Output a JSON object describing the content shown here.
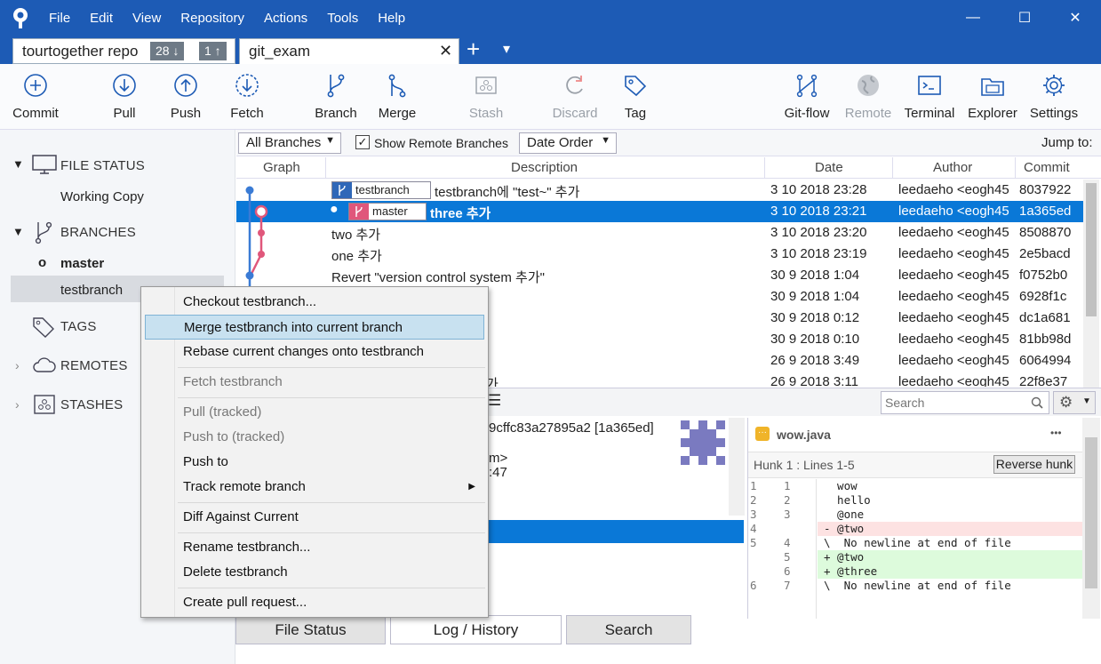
{
  "titlebar": {
    "menu": [
      "File",
      "Edit",
      "View",
      "Repository",
      "Actions",
      "Tools",
      "Help"
    ],
    "minimize_glyph": "—",
    "maximize_glyph": "☐",
    "close_glyph": "✕"
  },
  "tabs": {
    "tab1": {
      "label": "tourtogether repo",
      "behind": "28 ↓",
      "ahead": "1 ↑"
    },
    "tab2": {
      "label": "git_exam",
      "close": "✕"
    },
    "new_tab": "+",
    "dropdown": "▾"
  },
  "toolbar": {
    "commit": "Commit",
    "pull": "Pull",
    "push": "Push",
    "fetch": "Fetch",
    "branch": "Branch",
    "merge": "Merge",
    "stash": "Stash",
    "discard": "Discard",
    "tag": "Tag",
    "gitflow": "Git-flow",
    "remote": "Remote",
    "terminal": "Terminal",
    "explorer": "Explorer",
    "settings": "Settings"
  },
  "sidebar": {
    "file_status": "FILE STATUS",
    "working_copy": "Working Copy",
    "branches": "BRANCHES",
    "branch_master": "master",
    "branch_testbranch": "testbranch",
    "tags": "TAGS",
    "remotes": "REMOTES",
    "stashes": "STASHES"
  },
  "filterbar": {
    "branches_select": "All Branches",
    "show_remote_label": "Show Remote Branches",
    "show_remote_checked": true,
    "order_select": "Date Order",
    "jump_to": "Jump to:"
  },
  "log": {
    "headers": {
      "graph": "Graph",
      "description": "Description",
      "date": "Date",
      "author": "Author",
      "commit": "Commit"
    },
    "rows": [
      {
        "ref": "testbranch",
        "desc": "testbranch에 \"test~\" 추가",
        "date": "3 10 2018 23:28",
        "author": "leedaeho <eogh45",
        "commit": "8037922"
      },
      {
        "ref": "master",
        "desc": "three 추가",
        "date": "3 10 2018 23:21",
        "author": "leedaeho <eogh45",
        "commit": "1a365ed"
      },
      {
        "desc": "two 추가",
        "date": "3 10 2018 23:20",
        "author": "leedaeho <eogh45",
        "commit": "8508870"
      },
      {
        "desc": "one 추가",
        "date": "3 10 2018 23:19",
        "author": "leedaeho <eogh45",
        "commit": "2e5bacd"
      },
      {
        "desc": "Revert \"version control system 추가\"",
        "date": "30 9 2018 1:04",
        "author": "leedaeho <eogh45",
        "commit": "f0752b0"
      },
      {
        "desc": "",
        "date": "30 9 2018 1:04",
        "author": "leedaeho <eogh45",
        "commit": "6928f1c"
      },
      {
        "desc": "",
        "date": "30 9 2018 0:12",
        "author": "leedaeho <eogh45",
        "commit": "dc1a681"
      },
      {
        "desc": "",
        "date": "30 9 2018 0:10",
        "author": "leedaeho <eogh45",
        "commit": "81bb98d"
      },
      {
        "desc": "",
        "date": "26 9 2018 3:49",
        "author": "leedaeho <eogh45",
        "commit": "6064994"
      },
      {
        "desc": "가",
        "date": "26 9 2018 3:11",
        "author": "leedaeho <eogh45",
        "commit": "22f8e37"
      }
    ]
  },
  "details": {
    "hash_line": "9cffc83a27895a2 [1a365ed]",
    "line2": "m>",
    "line3": ":47"
  },
  "search": {
    "placeholder": "Search"
  },
  "diff": {
    "file": "wow.java",
    "more": "•••",
    "hunk": "Hunk 1 : Lines 1-5",
    "reverse": "Reverse hunk",
    "lines": [
      {
        "o": "1",
        "n": "1",
        "t": "  wow",
        "k": "ctx"
      },
      {
        "o": "2",
        "n": "2",
        "t": "  hello",
        "k": "ctx"
      },
      {
        "o": "3",
        "n": "3",
        "t": "  @one",
        "k": "ctx"
      },
      {
        "o": "4",
        "n": "",
        "t": "- @two",
        "k": "del"
      },
      {
        "o": "5",
        "n": "4",
        "t": "\\  No newline at end of file",
        "k": "ctx"
      },
      {
        "o": "",
        "n": "5",
        "t": "+ @two",
        "k": "add"
      },
      {
        "o": "",
        "n": "6",
        "t": "+ @three",
        "k": "add"
      },
      {
        "o": "6",
        "n": "7",
        "t": "\\  No newline at end of file",
        "k": "ctx"
      }
    ]
  },
  "bottom_tabs": {
    "file_status": "File Status",
    "log": "Log / History",
    "search": "Search"
  },
  "context_menu": {
    "checkout": "Checkout testbranch...",
    "merge": "Merge testbranch into current branch",
    "rebase": "Rebase current changes onto testbranch",
    "fetch": "Fetch testbranch",
    "pull": "Pull  (tracked)",
    "push_to_tracked": "Push to  (tracked)",
    "push_to": "Push to",
    "track_remote": "Track remote branch",
    "diff": "Diff Against Current",
    "rename": "Rename testbranch...",
    "delete": "Delete testbranch",
    "pull_request": "Create pull request..."
  },
  "colors": {
    "titlebar": "#1d5bb5",
    "selection": "#0a78d7",
    "menu_highlight": "#c8e1f0",
    "graph_blue": "#3a7bd5",
    "graph_pink": "#e0577b"
  }
}
